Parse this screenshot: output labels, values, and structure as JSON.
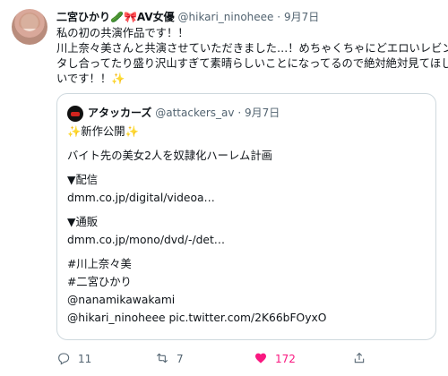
{
  "tweet": {
    "author": {
      "name": "二宮ひかり",
      "badge_emojis": "🥒🎀",
      "tag": "AV女優",
      "handle": "@hikari_ninoheee",
      "dot": "·",
      "date": "9月7日"
    },
    "text_lines": [
      "私の初の共演作品です！！",
      "川上奈々美さんと共演させていただきました…！めちゃくちゃにどエロいレビン",
      "タし合ってたり盛り沢山すぎて素晴らしいことになってるので絶対絶対見てほし",
      "いです！！"
    ],
    "text_end_emoji": "✨",
    "quoted": {
      "author": {
        "name": "アタッカーズ",
        "handle": "@attackers_av",
        "dot": "·",
        "date": "9月7日"
      },
      "lines": [
        "✨新作公開✨",
        "",
        "バイト先の美女2人を奴隷化ハーレム計画",
        "",
        "▼配信",
        "dmm.co.jp/digital/videoa…",
        "",
        "▼通販",
        "dmm.co.jp/mono/dvd/-/det…",
        "",
        "#川上奈々美",
        "#二宮ひかり",
        "@nanamikawakami",
        "@hikari_ninoheee pic.twitter.com/2K66bFOyxO"
      ]
    },
    "actions": {
      "reply_count": "11",
      "retweet_count": "7",
      "like_count": "172",
      "like_color": "#f91880",
      "icons": [
        "reply-icon",
        "retweet-icon",
        "heart-icon",
        "share-icon"
      ]
    }
  }
}
